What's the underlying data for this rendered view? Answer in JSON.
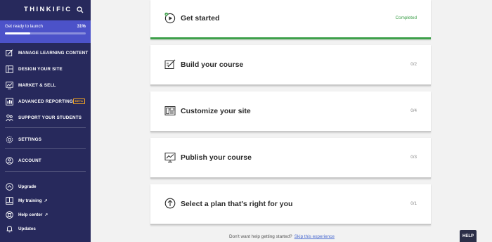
{
  "sidebar": {
    "logo": "THINKIFIC",
    "launch": {
      "label": "Get ready to launch",
      "percent_text": "31%",
      "progress": 0.31
    },
    "nav": [
      {
        "label": "MANAGE LEARNING CONTENT",
        "icon": "edit-content-icon"
      },
      {
        "label": "DESIGN YOUR SITE",
        "icon": "layout-icon"
      },
      {
        "label": "MARKET & SELL",
        "icon": "chart-icon"
      },
      {
        "label": "ADVANCED REPORTING",
        "icon": "report-icon",
        "badge": "BETA"
      },
      {
        "label": "SUPPORT YOUR STUDENTS",
        "icon": "students-icon"
      },
      {
        "label": "SETTINGS",
        "icon": "gear-icon"
      },
      {
        "label": "ACCOUNT",
        "icon": "user-icon"
      }
    ],
    "bottom": [
      {
        "label": "Upgrade",
        "icon": "upgrade-icon"
      },
      {
        "label": "My training",
        "icon": "training-icon",
        "external": "↗"
      },
      {
        "label": "Help center",
        "icon": "lifebuoy-icon",
        "external": "↗"
      },
      {
        "label": "Updates",
        "icon": "bell-icon"
      }
    ]
  },
  "steps": [
    {
      "title": "Get started",
      "status": "Completed",
      "icon": "play-icon"
    },
    {
      "title": "Build your course",
      "status": "0/2",
      "icon": "edit-course-icon"
    },
    {
      "title": "Customize your site",
      "status": "0/4",
      "icon": "customize-icon"
    },
    {
      "title": "Publish your course",
      "status": "0/3",
      "icon": "publish-icon"
    },
    {
      "title": "Select a plan that's right for you",
      "status": "0/1",
      "icon": "upload-arrow-icon"
    }
  ],
  "footer": {
    "text": "Don't want help getting started?",
    "link": "Skip this experience"
  },
  "help_label": "HELP",
  "colors": {
    "sidebar": "#27295c",
    "launch_bar": "#4c52c9",
    "completed": "#3da04a",
    "beta": "#f5a623",
    "link": "#4c6cd1"
  }
}
